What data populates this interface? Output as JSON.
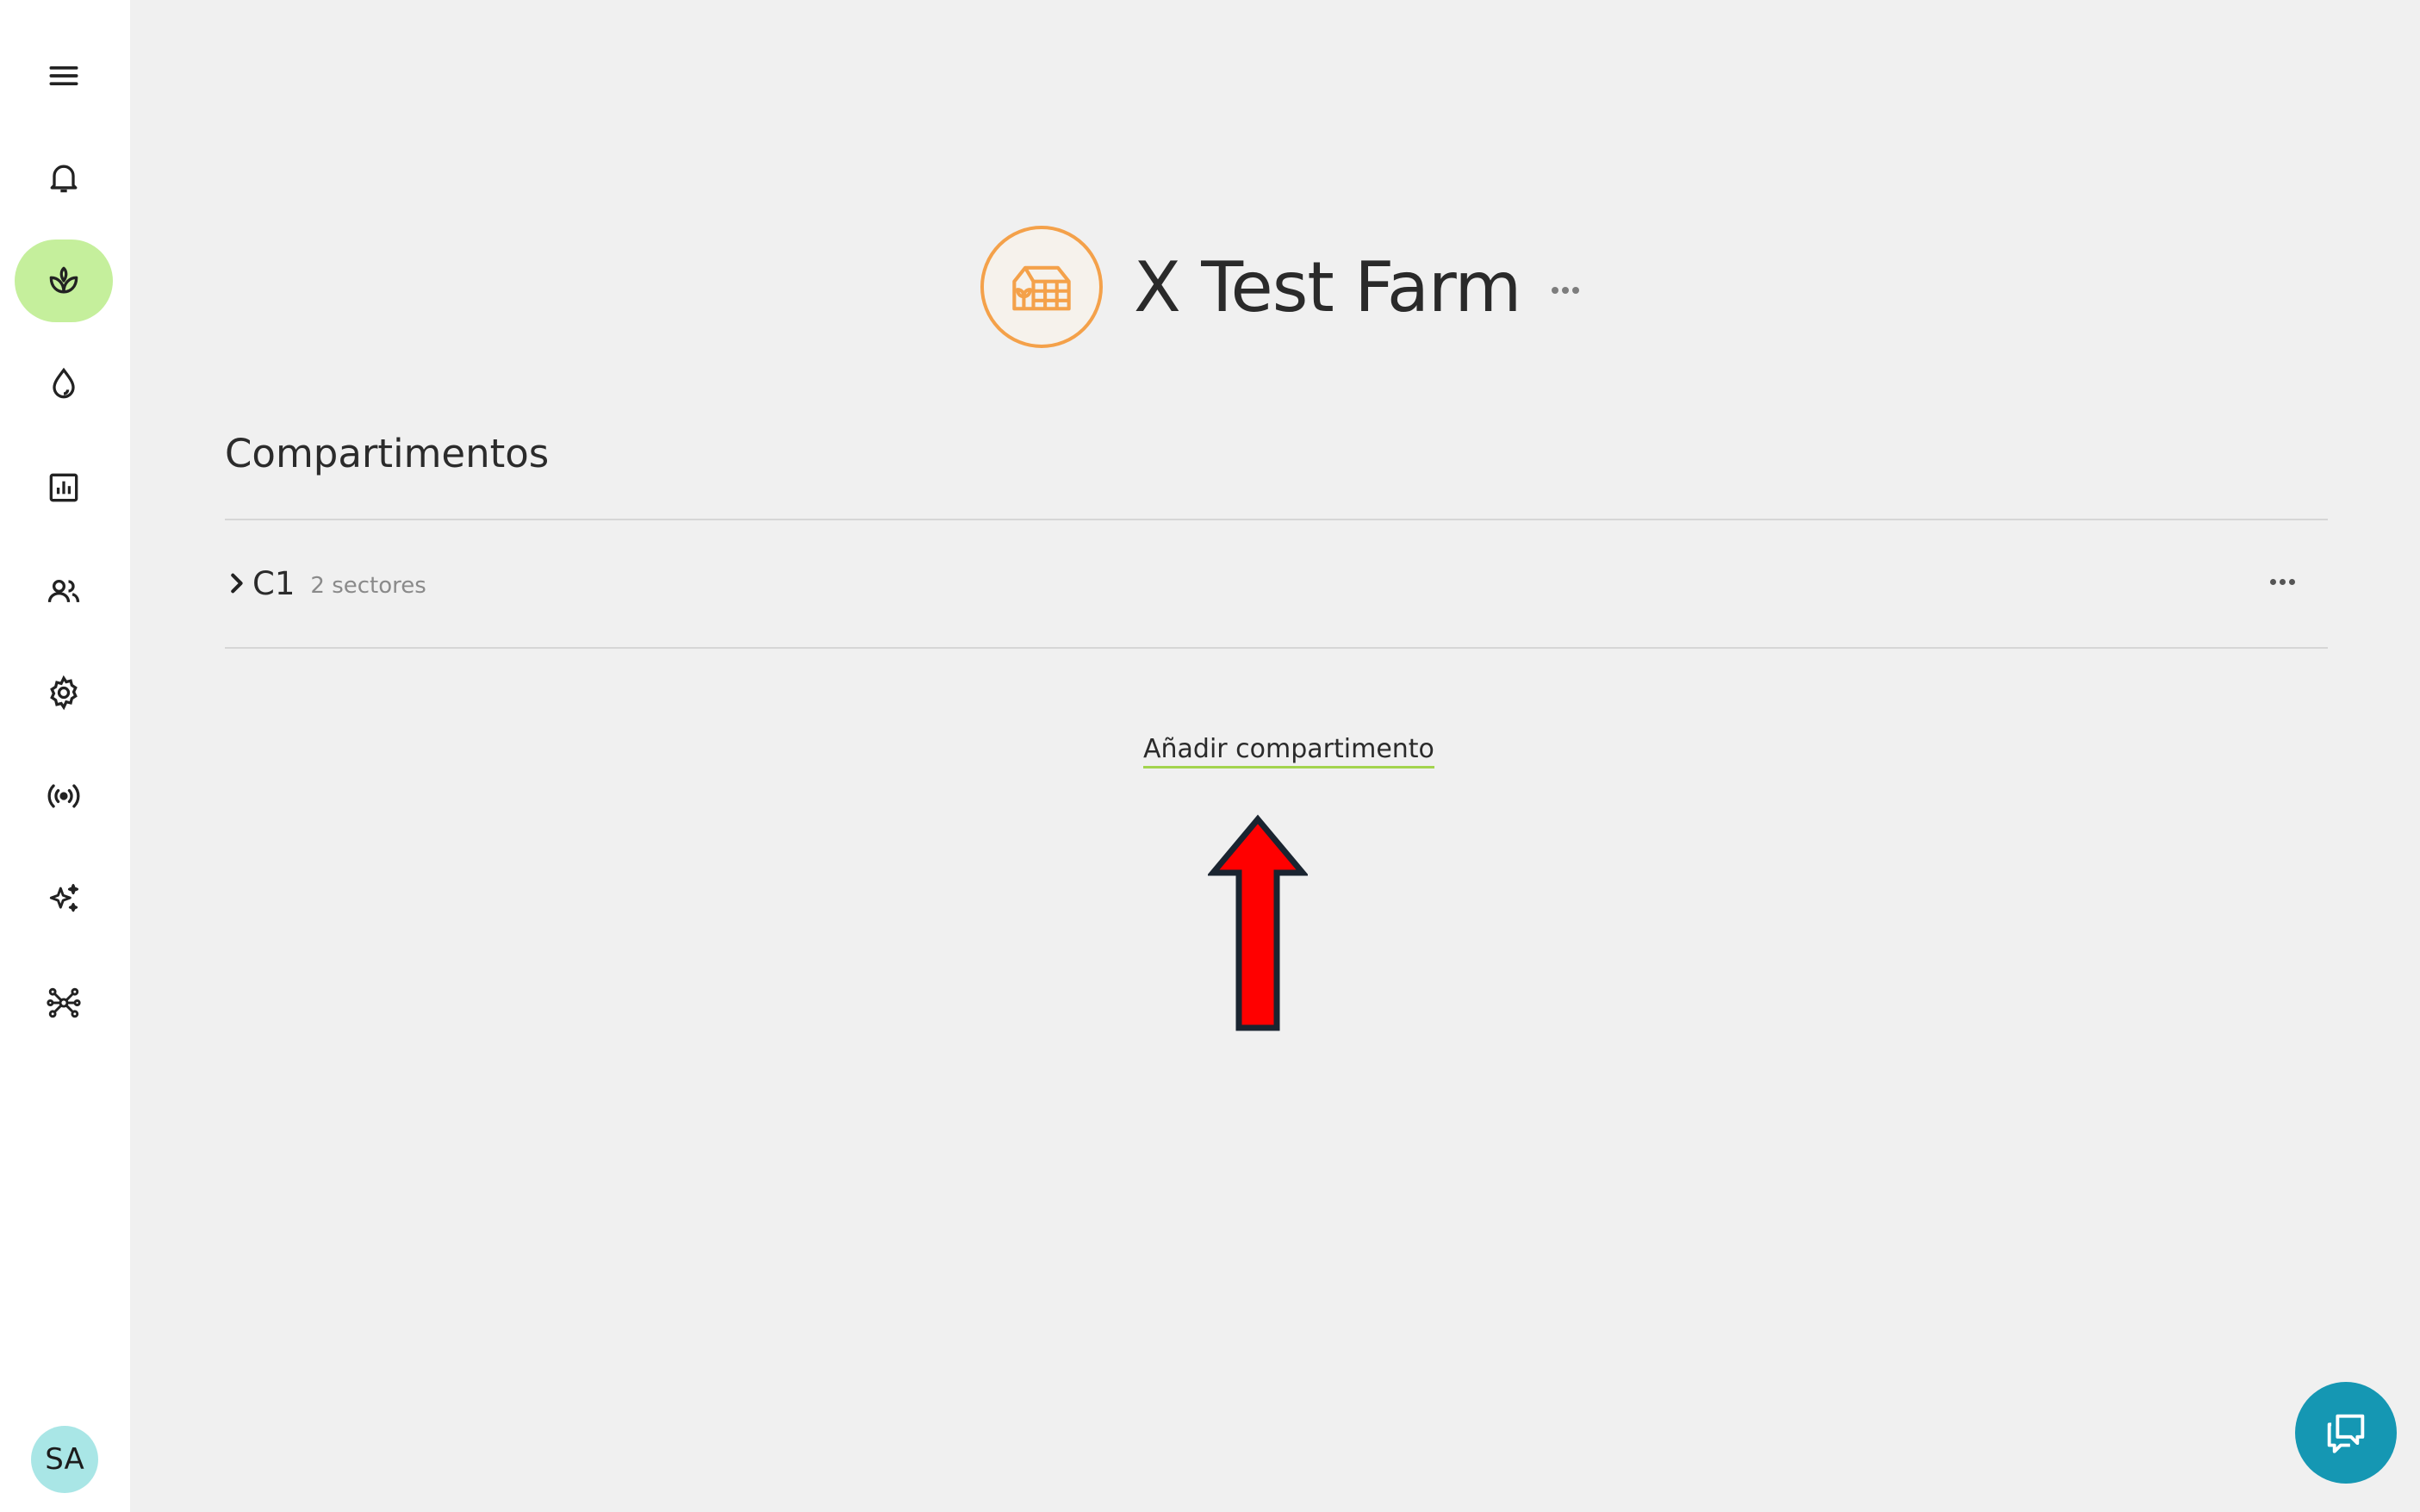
{
  "sidebar": {
    "items": [
      {
        "name": "menu-icon",
        "active": false
      },
      {
        "name": "bell-icon",
        "active": false
      },
      {
        "name": "plant-icon",
        "active": true
      },
      {
        "name": "water-drop-icon",
        "active": false
      },
      {
        "name": "chart-icon",
        "active": false
      },
      {
        "name": "users-icon",
        "active": false
      },
      {
        "name": "gear-icon",
        "active": false
      },
      {
        "name": "broadcast-icon",
        "active": false
      },
      {
        "name": "sparkle-icon",
        "active": false
      },
      {
        "name": "network-icon",
        "active": false
      }
    ],
    "avatar": "SA"
  },
  "header": {
    "farm_name": "X Test Farm",
    "logo_icon": "greenhouse-icon"
  },
  "section": {
    "title": "Compartimentos",
    "rows": [
      {
        "name": "C1",
        "meta": "2 sectores"
      }
    ],
    "add_label": "Añadir compartimento"
  },
  "colors": {
    "accent_green": "#c5ef9c",
    "logo_orange": "#f4a14a",
    "chat_teal": "#1597b3",
    "arrow_red": "#ff0000",
    "link_underline": "#a3d44e"
  }
}
